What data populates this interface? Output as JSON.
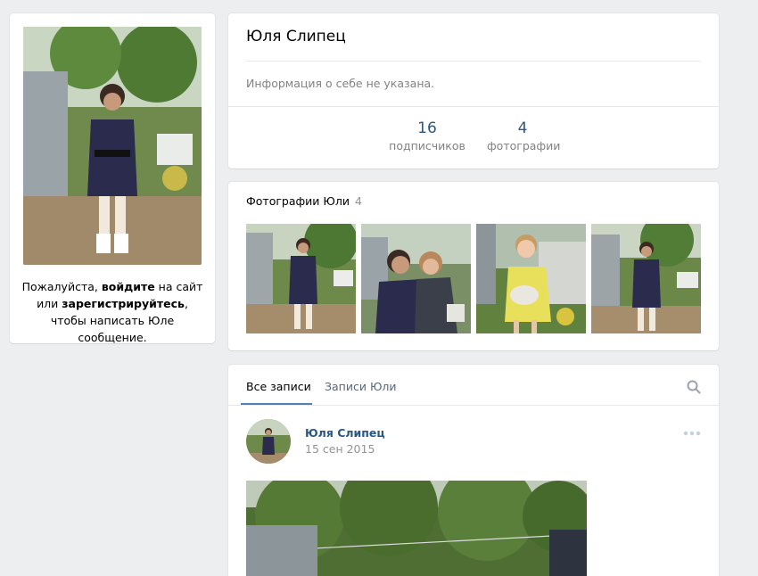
{
  "profile": {
    "name": "Юля Слипец",
    "about": "Информация о себе не указана.",
    "followers_count": "16",
    "followers_label": "подписчиков",
    "photos_count": "4",
    "photos_label": "фотографии"
  },
  "left": {
    "note_pre": "Пожалуйста, ",
    "login_link": "войдите",
    "note_mid": " на сайт или ",
    "register_link": "зарегистрируйтесь",
    "note_post": ", чтобы написать Юле сообщение."
  },
  "photos": {
    "title": "Фотографии Юли",
    "count": "4",
    "items": [
      {
        "icon": "photo-woman-dress"
      },
      {
        "icon": "photo-two-women"
      },
      {
        "icon": "photo-girl-yellow"
      },
      {
        "icon": "photo-woman-dress"
      }
    ]
  },
  "wall": {
    "tab_all": "Все записи",
    "tab_user": "Записи Юли",
    "search_icon": "search-icon",
    "post": {
      "author": "Юля Слипец",
      "date": "15 сен 2015",
      "more_icon": "more-icon"
    }
  },
  "colors": {
    "background": "#edeef0",
    "link": "#2a5885",
    "muted": "#828282",
    "accent": "#5181b8"
  }
}
